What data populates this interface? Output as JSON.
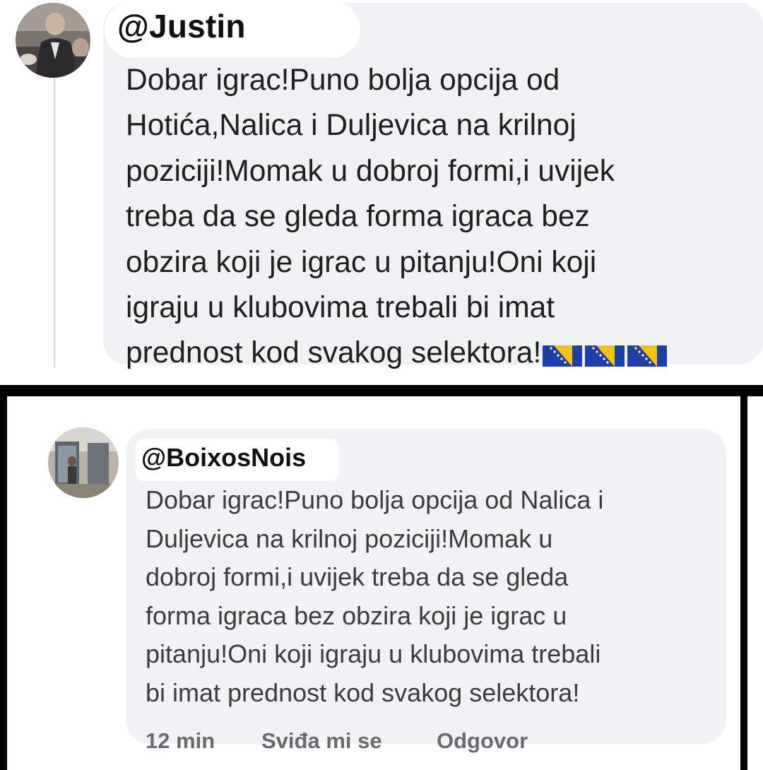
{
  "top_comment": {
    "username": "@Justin",
    "lines": [
      "Dobar igrac!Puno bolja opcija od",
      "Hotića,Nalica i Duljevica na krilnoj",
      "poziciji!Momak u dobroj formi,i uvijek",
      "treba da se gleda forma igraca bez",
      "obzira koji je igrac u pitanju!Oni koji",
      "igraju u klubovima trebali bi imat",
      "prednost kod svakog selektora!"
    ],
    "emoji": [
      "bosnia-flag-icon",
      "bosnia-flag-icon",
      "bosnia-flag-icon"
    ],
    "flag_colors": {
      "blue": "#1f3fa8",
      "yellow": "#f7c300"
    }
  },
  "bottom_comment": {
    "username": "@BoixosNois",
    "lines": [
      "Dobar igrac!Puno bolja opcija od Nalica i",
      "Duljevica na krilnoj poziciji!Momak u",
      "dobroj formi,i uvijek treba da se gleda",
      "forma igraca bez obzira koji je igrac u",
      "pitanju!Oni koji igraju u klubovima trebali",
      "bi imat prednost kod svakog selektora!"
    ],
    "actions": {
      "time": "12 min",
      "like": "Sviđa mi se",
      "reply": "Odgovor"
    }
  },
  "colors": {
    "bubble": "#eff1f4",
    "separator": "#000000",
    "action_text": "#686b70"
  }
}
